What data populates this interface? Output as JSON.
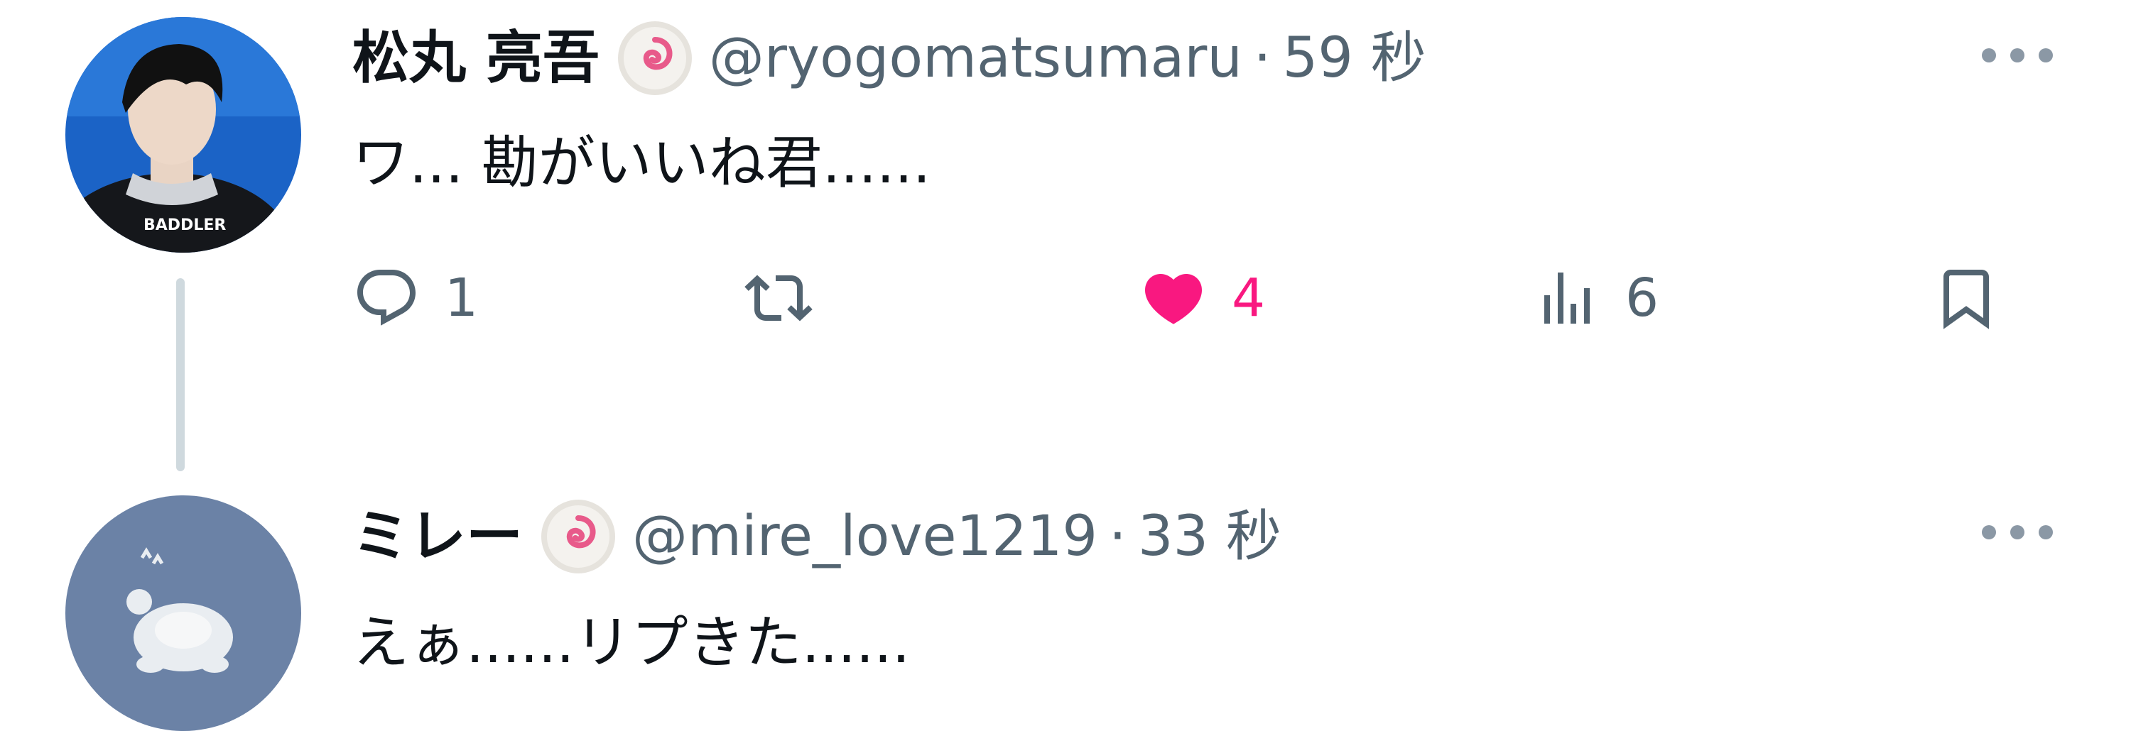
{
  "colors": {
    "accent_like": "#f91880",
    "muted": "#536471",
    "text": "#0f1419",
    "thread_line": "#cfd9de"
  },
  "tweets": [
    {
      "name": "松丸 亮吾",
      "badge_icon": "naruto-badge-icon",
      "handle": "@ryogomatsumaru",
      "separator": "·",
      "time": "59 秒",
      "text": "ワ... 勘がいいね君......",
      "actions": {
        "reply_count": "1",
        "retweet_count": "",
        "like_count": "4",
        "views_count": "6"
      }
    },
    {
      "name": "ミレー",
      "badge_icon": "naruto-badge-icon",
      "handle": "@mire_love1219",
      "separator": "·",
      "time": "33 秒",
      "text": "えぁ......リプきた......"
    }
  ]
}
